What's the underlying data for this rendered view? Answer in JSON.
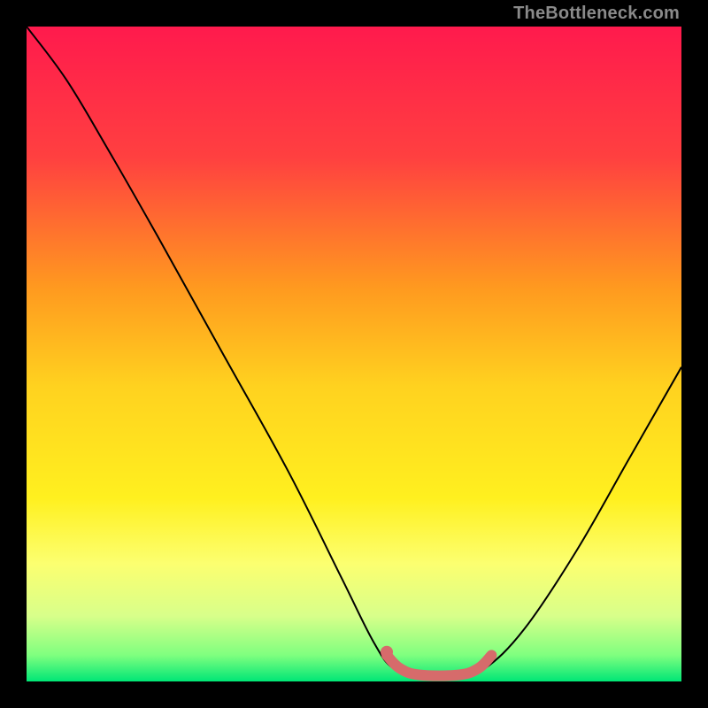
{
  "watermark": "TheBottleneck.com",
  "chart_data": {
    "type": "line",
    "title": "",
    "xlabel": "",
    "ylabel": "",
    "xlim": [
      0,
      100
    ],
    "ylim": [
      0,
      100
    ],
    "grid": false,
    "legend": false,
    "background_gradient": {
      "stops": [
        {
          "offset": 0.0,
          "color": "#ff1a4d"
        },
        {
          "offset": 0.2,
          "color": "#ff4040"
        },
        {
          "offset": 0.4,
          "color": "#ff9a1f"
        },
        {
          "offset": 0.55,
          "color": "#ffd21f"
        },
        {
          "offset": 0.72,
          "color": "#fff01f"
        },
        {
          "offset": 0.82,
          "color": "#fcff70"
        },
        {
          "offset": 0.9,
          "color": "#d8ff8a"
        },
        {
          "offset": 0.96,
          "color": "#7fff7f"
        },
        {
          "offset": 1.0,
          "color": "#00e676"
        }
      ]
    },
    "series": [
      {
        "name": "bottleneck-curve",
        "stroke": "#000000",
        "stroke_width": 2,
        "points": [
          {
            "x": 0,
            "y": 100
          },
          {
            "x": 6,
            "y": 92
          },
          {
            "x": 12,
            "y": 82
          },
          {
            "x": 20,
            "y": 68
          },
          {
            "x": 30,
            "y": 50
          },
          {
            "x": 40,
            "y": 32
          },
          {
            "x": 48,
            "y": 16
          },
          {
            "x": 53,
            "y": 6
          },
          {
            "x": 56,
            "y": 2
          },
          {
            "x": 60,
            "y": 1
          },
          {
            "x": 66,
            "y": 1
          },
          {
            "x": 70,
            "y": 2
          },
          {
            "x": 76,
            "y": 8
          },
          {
            "x": 84,
            "y": 20
          },
          {
            "x": 92,
            "y": 34
          },
          {
            "x": 100,
            "y": 48
          }
        ]
      },
      {
        "name": "optimal-zone-marker",
        "stroke": "#d66b6b",
        "stroke_width": 12,
        "linecap": "round",
        "points": [
          {
            "x": 55,
            "y": 4
          },
          {
            "x": 57,
            "y": 2
          },
          {
            "x": 60,
            "y": 1
          },
          {
            "x": 66,
            "y": 1
          },
          {
            "x": 69,
            "y": 2
          },
          {
            "x": 71,
            "y": 4
          }
        ]
      }
    ],
    "markers": [
      {
        "name": "optimal-point-dot",
        "x": 55,
        "y": 4.5,
        "r": 7,
        "fill": "#d66b6b"
      }
    ]
  }
}
